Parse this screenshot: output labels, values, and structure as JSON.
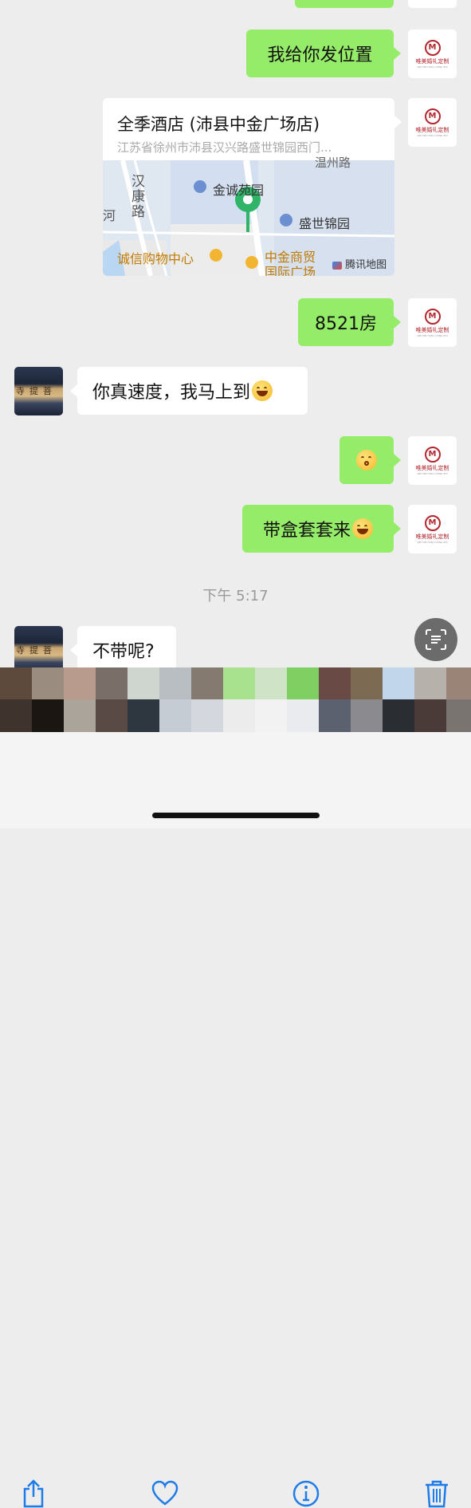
{
  "messages": {
    "location_text": "我给你发位置",
    "location_card": {
      "title": "全季酒店 (沛县中金广场店)",
      "address": "江苏省徐州市沛县汉兴路盛世锦园西门...",
      "map_labels": {
        "road1": "汉康路",
        "road2": "河",
        "road3": "温州路",
        "poi1": "金诚苑园",
        "poi2": "盛世锦园",
        "poi3": "诚信购物中心",
        "poi4": "中金商贸",
        "poi4b": "国际广场",
        "brand": "腾讯地图"
      }
    },
    "room": "8521房",
    "reply1": "你真速度，我马上到",
    "reply_kiss": "",
    "condom": "带盒套套来",
    "timestamp": "下午 5:17",
    "reply2": "不带呢?"
  },
  "avatar": {
    "right_logo_letter": "M",
    "right_logo_text": "唯美婚礼定制",
    "right_logo_sub": "WEI MEI HUN LI DING ZHI",
    "left_sign": "寺提菩"
  },
  "toolbar": {
    "share": "share-icon",
    "like": "heart-icon",
    "info": "info-icon",
    "delete": "trash-icon"
  },
  "colors": {
    "green_bubble": "#95ec69",
    "background": "#ededed",
    "accent_blue": "#1e7ce8"
  }
}
